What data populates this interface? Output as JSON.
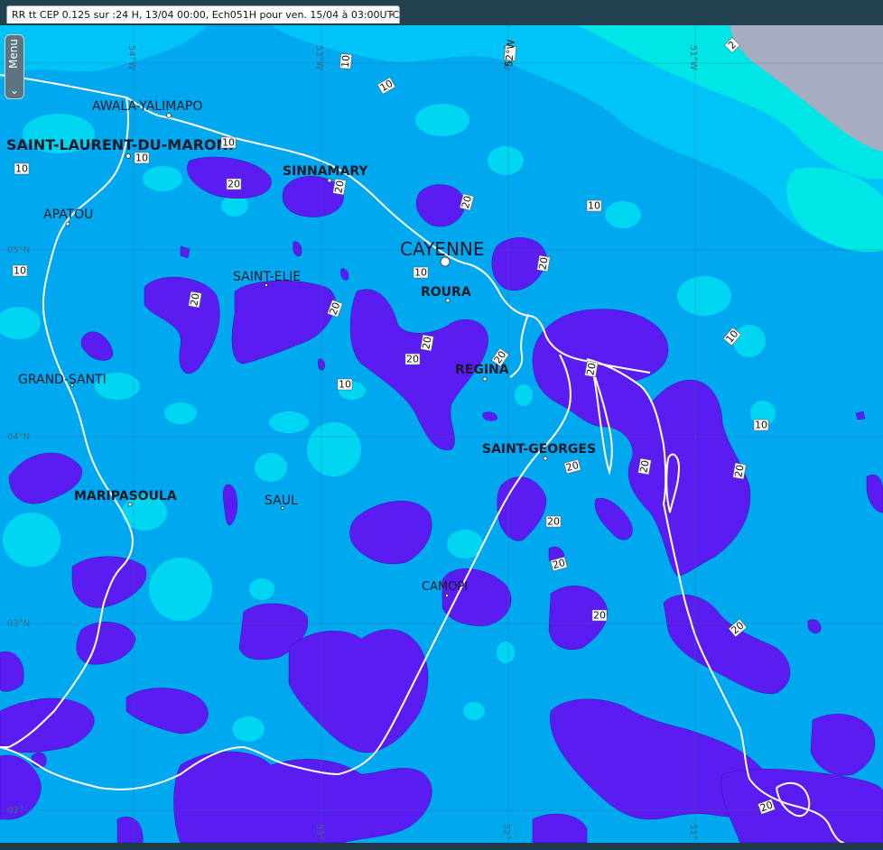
{
  "tab": {
    "title": "RR tt CEP 0.125 sur :24 H, 13/04 00:00, Ech051H pour ven. 15/04 à 03:00UTC",
    "close_glyph": "×"
  },
  "menu": {
    "label": "Menu",
    "chevron": "❯"
  },
  "colors": {
    "low": "#00e5e5",
    "mid": "#00bfff",
    "base": "#00a8f0",
    "high": "#5a1cf0",
    "land": "#a6adc0",
    "border": "#ffffff"
  },
  "cities": [
    {
      "name": "AWALA-YALIMAPO"
    },
    {
      "name": "SAINT-LAURENT-DU-MARONI"
    },
    {
      "name": "SINNAMARY"
    },
    {
      "name": "APATOU"
    },
    {
      "name": "CAYENNE"
    },
    {
      "name": "SAINT-ELIE"
    },
    {
      "name": "ROURA"
    },
    {
      "name": "REGINA"
    },
    {
      "name": "GRAND-SANTI"
    },
    {
      "name": "SAINT-GEORGES"
    },
    {
      "name": "MARIPASOULA"
    },
    {
      "name": "SAUL"
    },
    {
      "name": "CAMOPI"
    }
  ],
  "contours": [
    "10",
    "10",
    "10",
    "10",
    "10",
    "10",
    "10",
    "10",
    "10",
    "10",
    "10",
    "10",
    "20",
    "20",
    "20",
    "20",
    "20",
    "20",
    "20",
    "20",
    "20",
    "20",
    "20",
    "20",
    "20",
    "20",
    "20",
    "20",
    "20",
    "20",
    "20",
    "2"
  ],
  "grid_labels": [
    "54°W",
    "53°W",
    "52°W",
    "51°W",
    "05°N",
    "04°N",
    "03°N",
    "52°",
    "51°",
    "53°",
    "02°"
  ]
}
